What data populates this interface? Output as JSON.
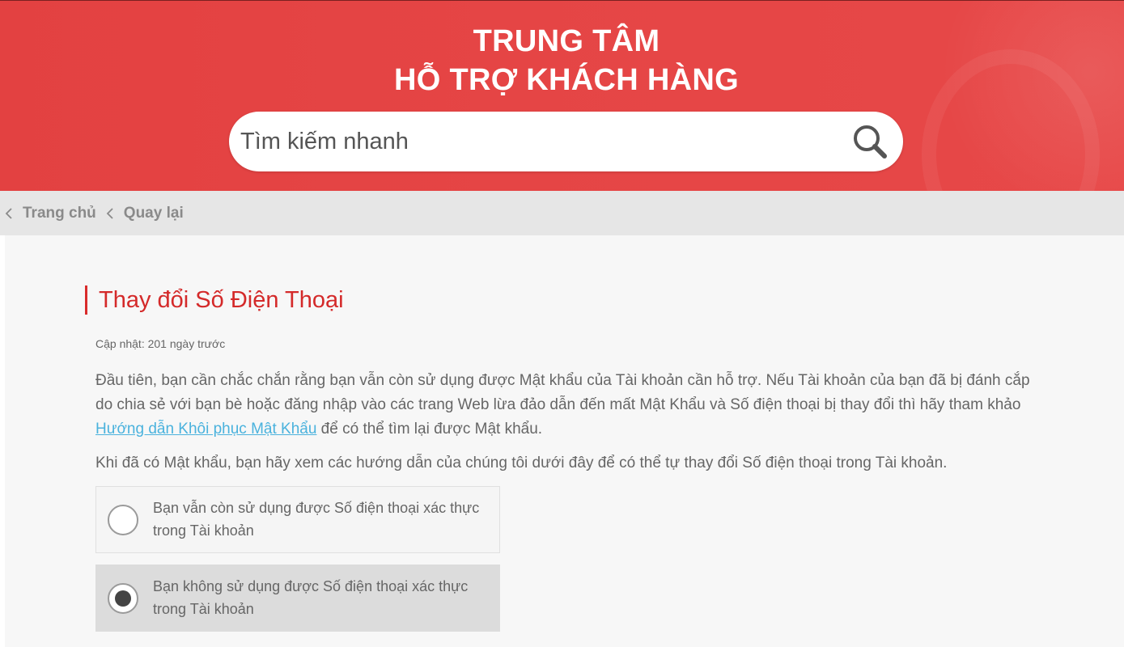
{
  "header": {
    "title_line1": "TRUNG TÂM",
    "title_line2": "HỖ TRỢ KHÁCH HÀNG",
    "search_placeholder": "Tìm kiếm nhanh",
    "search_icon": "search-icon"
  },
  "breadcrumb": {
    "items": [
      {
        "label": "Trang chủ",
        "icon": "chevron-left-icon"
      },
      {
        "label": "Quay lại",
        "icon": "chevron-left-icon"
      }
    ]
  },
  "article": {
    "title": "Thay đổi Số Điện Thoại",
    "updated": "Cập nhật: 201 ngày trước",
    "para1_before_link": "Đầu tiên, bạn cần chắc chắn rằng bạn vẫn còn sử dụng được Mật khẩu của Tài khoản cần hỗ trợ. Nếu Tài khoản của bạn đã bị đánh cắp do chia sẻ với bạn bè hoặc đăng nhập vào các trang Web lừa đảo dẫn đến mất Mật Khẩu và Số điện thoại bị thay đổi thì hãy tham khảo ",
    "para1_link": "Hướng dẫn Khôi phục Mật Khẩu",
    "para1_after_link": " để có thể tìm lại được Mật khẩu.",
    "para2": "Khi đã có Mật khẩu, bạn hãy xem các hướng dẫn của chúng tôi dưới đây để có thể tự thay đổi Số điện thoại trong Tài khoản.",
    "options": [
      {
        "label": "Bạn vẫn còn sử dụng được Số điện thoại xác thực trong Tài khoản",
        "selected": false
      },
      {
        "label": "Bạn không sử dụng được Số điện thoại xác thực trong Tài khoản",
        "selected": true
      }
    ]
  },
  "colors": {
    "brand_red": "#e54545",
    "title_red": "#d42a2a",
    "link_blue": "#4ab2dd"
  }
}
